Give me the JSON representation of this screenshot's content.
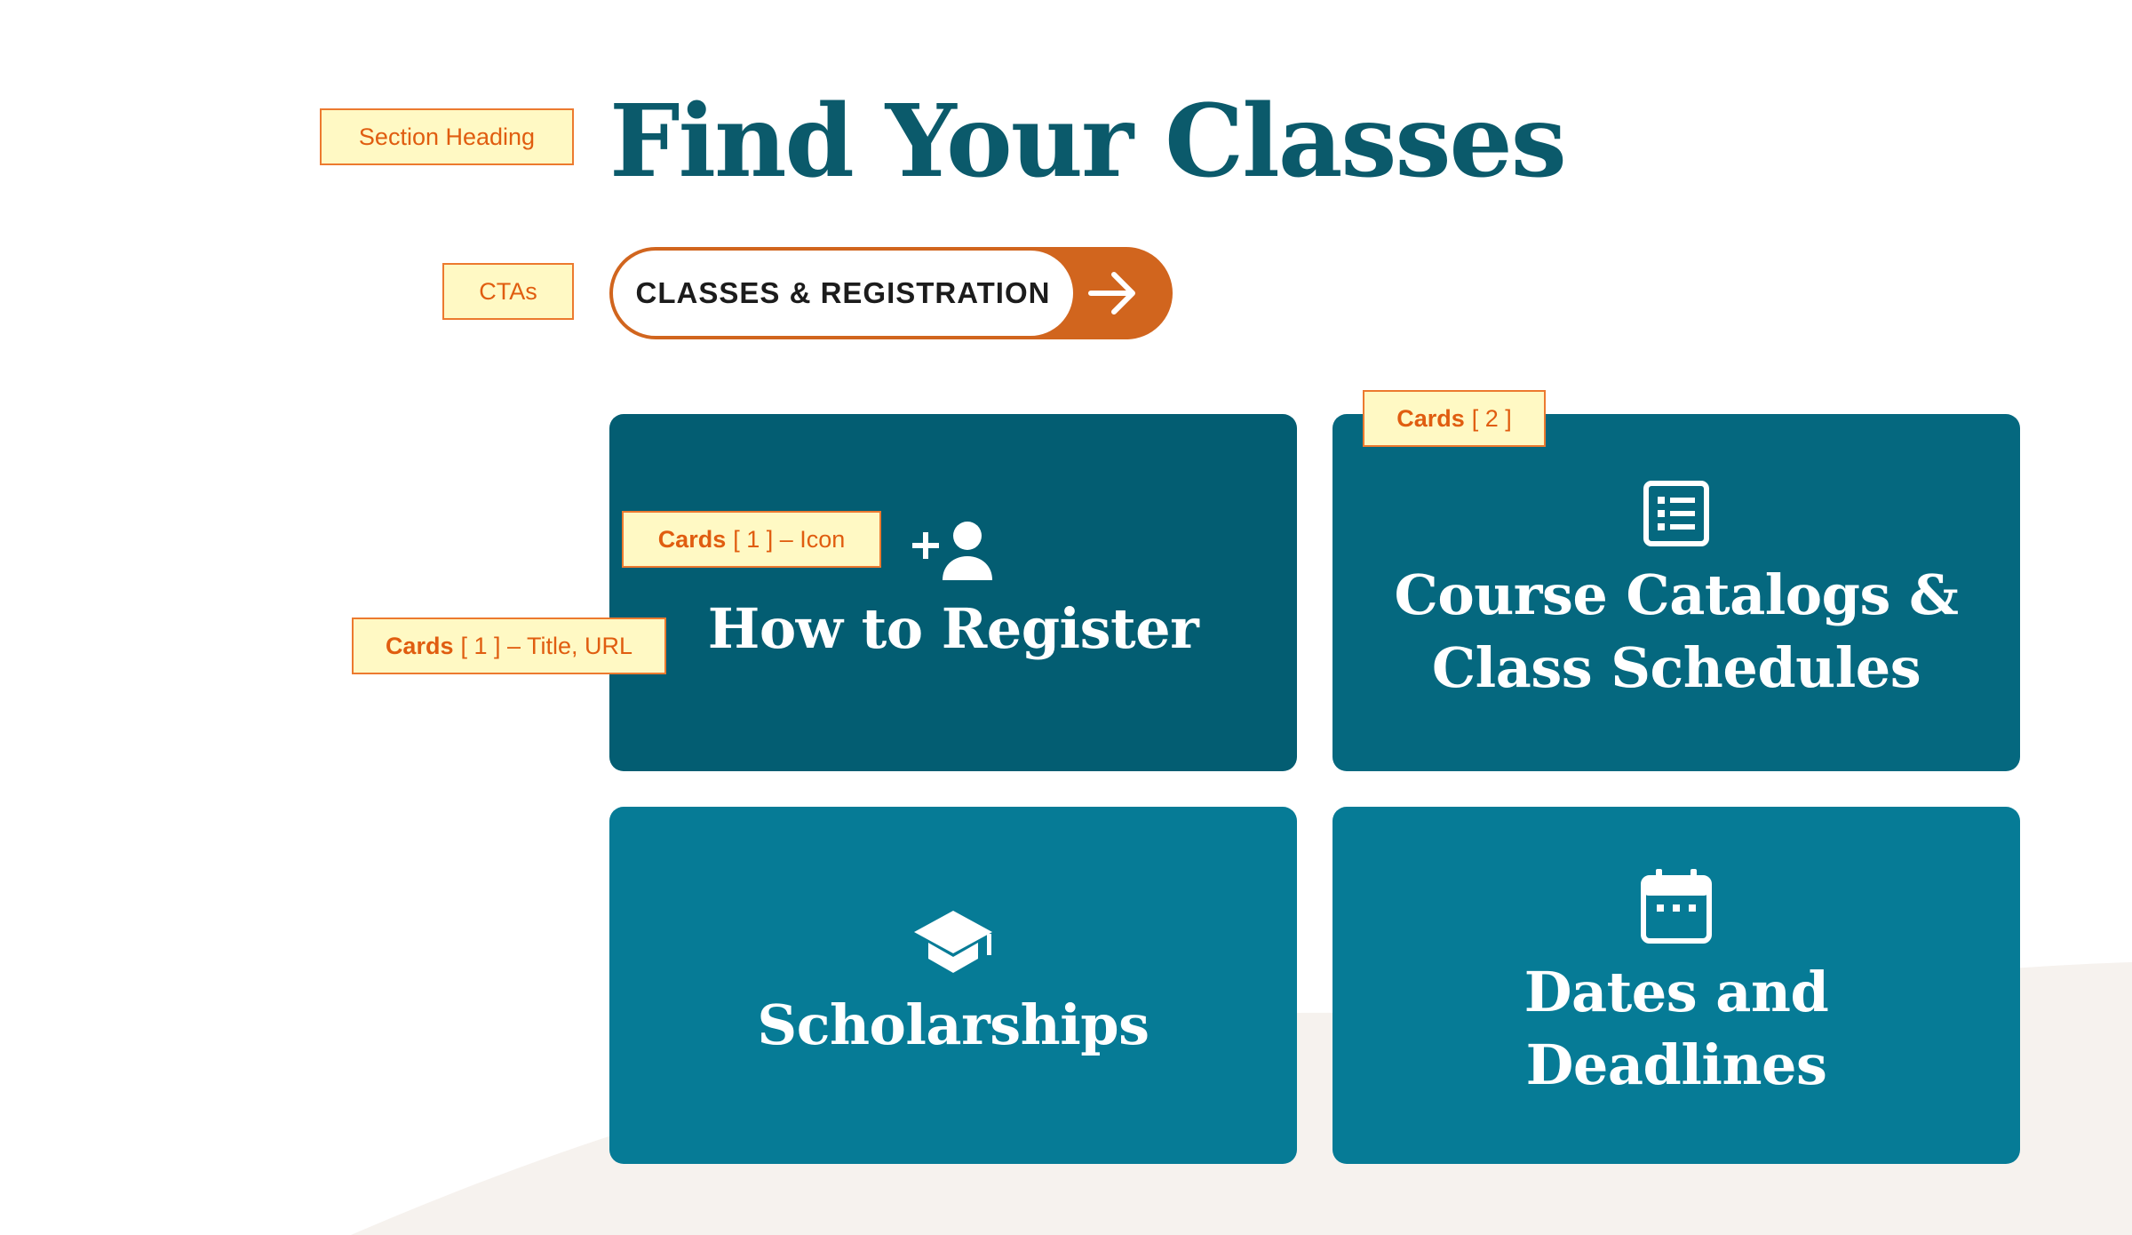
{
  "heading": {
    "title": "Find Your Classes"
  },
  "cta": {
    "label": "CLASSES & REGISTRATION",
    "icon": "arrow-right-icon"
  },
  "cards": [
    {
      "title": "How to Register",
      "icon": "add-person-icon"
    },
    {
      "title": "Course Catalogs & Class Schedules",
      "icon": "list-document-icon"
    },
    {
      "title": "Scholarships",
      "icon": "graduation-cap-icon"
    },
    {
      "title": "Dates and Deadlines",
      "icon": "calendar-icon"
    }
  ],
  "annotations": {
    "section_heading": "Section Heading",
    "ctas": "CTAs",
    "cards_2": {
      "bold": "Cards",
      "rest": "[ 2 ]"
    },
    "cards_1_icon": {
      "bold": "Cards",
      "rest": "[ 1 ] – Icon"
    },
    "cards_1_title": {
      "bold": "Cards",
      "rest": "[ 1 ] – Title, URL"
    }
  },
  "colors": {
    "heading": "#0b5a6b",
    "cta_accent": "#d1651e",
    "card_dark": "#035d72",
    "card_mid": "#05687f",
    "card_light": "#067b96",
    "annotation_bg": "#fff9c4",
    "annotation_text": "#e05d10",
    "background_wave": "#f6f2ee"
  }
}
